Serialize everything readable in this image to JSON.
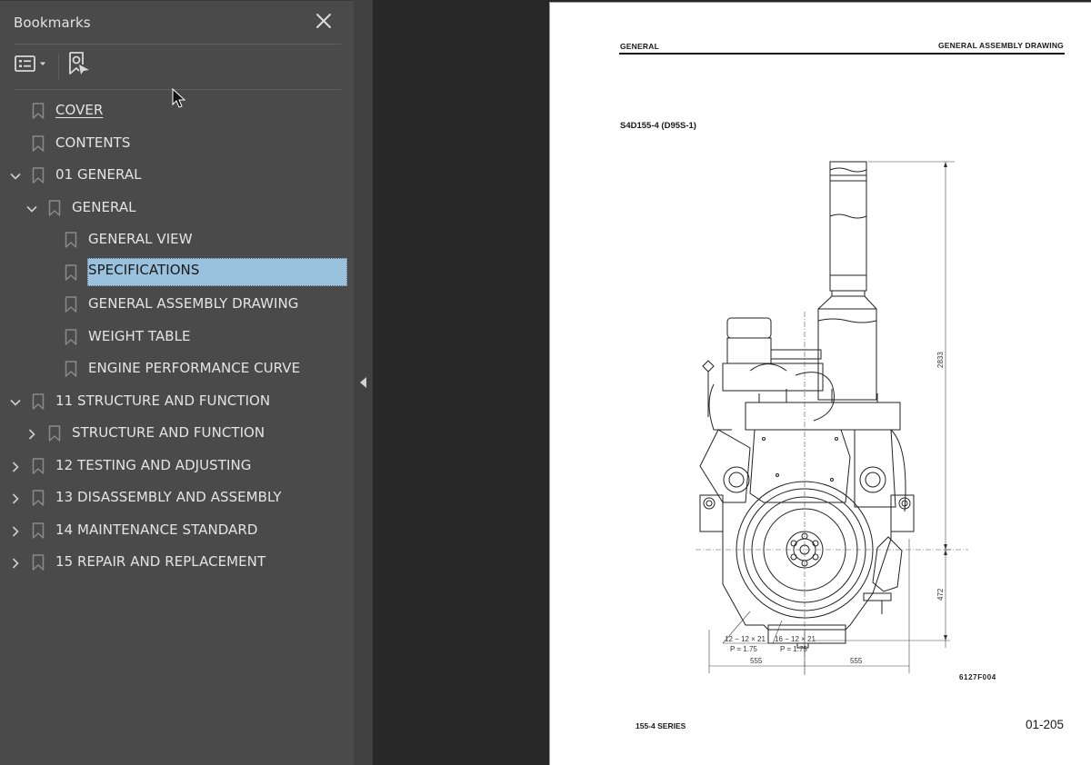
{
  "sidebar": {
    "title": "Bookmarks",
    "close_icon": "close-icon",
    "toolbar": {
      "options_icon": "list-options-icon",
      "find_icon": "find-current-bookmark-icon"
    },
    "items": [
      {
        "label": "COVER",
        "level": 0,
        "twisty": "none",
        "state": "link"
      },
      {
        "label": "CONTENTS",
        "level": 0,
        "twisty": "none",
        "state": "normal"
      },
      {
        "label": "01 GENERAL",
        "level": 0,
        "twisty": "expanded",
        "state": "normal"
      },
      {
        "label": "GENERAL",
        "level": 1,
        "twisty": "expanded",
        "state": "normal"
      },
      {
        "label": "GENERAL VIEW",
        "level": 2,
        "twisty": "none",
        "state": "normal"
      },
      {
        "label": "SPECIFICATIONS",
        "level": 2,
        "twisty": "none",
        "state": "selected"
      },
      {
        "label": "GENERAL ASSEMBLY DRAWING",
        "level": 2,
        "twisty": "none",
        "state": "normal"
      },
      {
        "label": "WEIGHT TABLE",
        "level": 2,
        "twisty": "none",
        "state": "normal"
      },
      {
        "label": "ENGINE PERFORMANCE CURVE",
        "level": 2,
        "twisty": "none",
        "state": "normal"
      },
      {
        "label": "11 STRUCTURE AND FUNCTION",
        "level": 0,
        "twisty": "expanded",
        "state": "normal"
      },
      {
        "label": "STRUCTURE AND FUNCTION",
        "level": 1,
        "twisty": "collapsed",
        "state": "normal"
      },
      {
        "label": "12 TESTING AND ADJUSTING",
        "level": 0,
        "twisty": "collapsed",
        "state": "normal"
      },
      {
        "label": "13 DISASSEMBLY AND ASSEMBLY",
        "level": 0,
        "twisty": "collapsed",
        "state": "normal"
      },
      {
        "label": "14 MAINTENANCE STANDARD",
        "level": 0,
        "twisty": "collapsed",
        "state": "normal"
      },
      {
        "label": "15 REPAIR AND REPLACEMENT",
        "level": 0,
        "twisty": "collapsed",
        "state": "normal"
      }
    ],
    "colors": {
      "background": "#4a4a4a",
      "text": "#e4e4e4",
      "selection": "#9ac1dd"
    }
  },
  "splitter": {
    "collapse_icon": "collapse-left-icon"
  },
  "page": {
    "header_left": "GENERAL",
    "header_right": "GENERAL ASSEMBLY DRAWING",
    "model": "S4D155-4 (D95S-1)",
    "figure_id": "6127F004",
    "footer_left": "155-4 SERIES",
    "page_number": "01-205",
    "drawing": {
      "subject": "engine-front-view",
      "dim_height_total": "2833",
      "dim_height_center": "472",
      "dim_width_left": "555",
      "dim_width_right": "555",
      "note_1_line1": "12 − 12 × 21",
      "note_1_line2": "P = 1.75",
      "note_2_line1": "16 − 12 × 21",
      "note_2_line2": "P = 1.75"
    }
  }
}
